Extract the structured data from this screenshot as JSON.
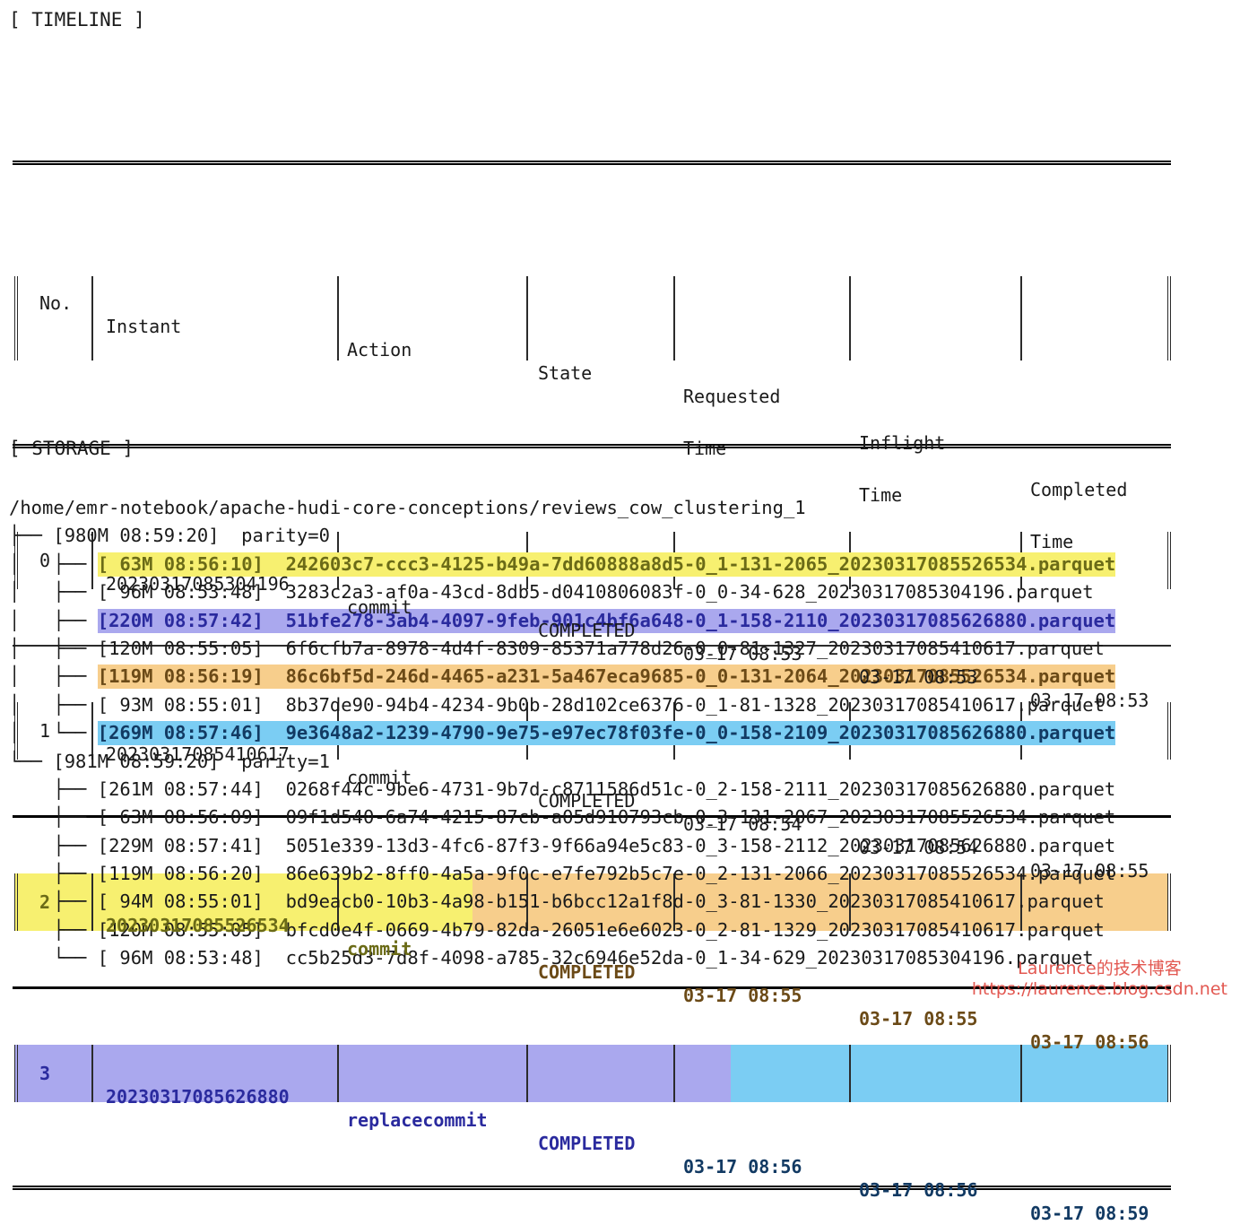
{
  "colors": {
    "yellow": "#f7f070",
    "orange": "#f7ce8c",
    "purple": "#aaa8ee",
    "blue": "#7bcdf3",
    "yellow_text": "#6b6b17",
    "orange_text": "#6b4a17",
    "purple_text": "#2a2a9e",
    "blue_text": "#123a63",
    "watermark": "#e04a43",
    "text": "#1a1a1a"
  },
  "timeline": {
    "heading": "[ TIMELINE ]",
    "columns": [
      {
        "label": "No."
      },
      {
        "label": "Instant"
      },
      {
        "label": "Action"
      },
      {
        "label": "State"
      },
      {
        "label": "Requested\nTime"
      },
      {
        "label": "Inflight\nTime"
      },
      {
        "label": "Completed\nTime"
      }
    ],
    "column_headers_flat": [
      "No.",
      "Instant",
      "Action",
      "State",
      "Requested Time",
      "Inflight Time",
      "Completed Time"
    ],
    "rows": [
      {
        "no": "0",
        "instant": "20230317085304196",
        "action": "commit",
        "state": "COMPLETED",
        "requested_time": "03-17 08:53",
        "inflight_time": "03-17 08:53",
        "completed_time": "03-17 08:53",
        "highlight": "none"
      },
      {
        "no": "1",
        "instant": "20230317085410617",
        "action": "commit",
        "state": "COMPLETED",
        "requested_time": "03-17 08:54",
        "inflight_time": "03-17 08:54",
        "completed_time": "03-17 08:55",
        "highlight": "none"
      },
      {
        "no": "2",
        "instant": "20230317085526534",
        "action": "commit",
        "state": "COMPLETED",
        "requested_time": "03-17 08:55",
        "inflight_time": "03-17 08:55",
        "completed_time": "03-17 08:56",
        "highlight": "yellow-orange"
      },
      {
        "no": "3",
        "instant": "20230317085626880",
        "action": "replacecommit",
        "state": "COMPLETED",
        "requested_time": "03-17 08:56",
        "inflight_time": "03-17 08:56",
        "completed_time": "03-17 08:59",
        "highlight": "purple-blue"
      }
    ]
  },
  "storage": {
    "heading": "[ STORAGE ]",
    "root_path": "/home/emr-notebook/apache-hudi-core-conceptions/reviews_cow_clustering_1",
    "groups": [
      {
        "connector": "├──",
        "size": "980M",
        "time": "08:59:20",
        "label": "parity=0",
        "files": [
          {
            "connector": "├──",
            "size": " 63M",
            "time": "08:56:10",
            "name": "242603c7-ccc3-4125-b49a-7dd60888a8d5-0_1-131-2065_20230317085526534.parquet",
            "highlight": "yellow"
          },
          {
            "connector": "├──",
            "size": " 96M",
            "time": "08:53:48",
            "name": "3283c2a3-af0a-43cd-8db5-d0410806083f-0_0-34-628_20230317085304196.parquet",
            "highlight": "none"
          },
          {
            "connector": "├──",
            "size": "220M",
            "time": "08:57:42",
            "name": "51bfe278-3ab4-4097-9feb-901c4bf6a648-0_1-158-2110_20230317085626880.parquet",
            "highlight": "purple"
          },
          {
            "connector": "├──",
            "size": "120M",
            "time": "08:55:05",
            "name": "6f6cfb7a-8978-4d4f-8309-85371a778d26-0_0-81-1327_20230317085410617.parquet",
            "highlight": "none"
          },
          {
            "connector": "├──",
            "size": "119M",
            "time": "08:56:19",
            "name": "86c6bf5d-246d-4465-a231-5a467eca9685-0_0-131-2064_20230317085526534.parquet",
            "highlight": "orange"
          },
          {
            "connector": "├──",
            "size": " 93M",
            "time": "08:55:01",
            "name": "8b37de90-94b4-4234-9b0b-28d102ce6376-0_1-81-1328_20230317085410617.parquet",
            "highlight": "none"
          },
          {
            "connector": "└──",
            "size": "269M",
            "time": "08:57:46",
            "name": "9e3648a2-1239-4790-9e75-e97ec78f03fe-0_0-158-2109_20230317085626880.parquet",
            "highlight": "blue"
          }
        ]
      },
      {
        "connector": "└──",
        "size": "981M",
        "time": "08:59:20",
        "label": "parity=1",
        "files": [
          {
            "connector": "├──",
            "size": "261M",
            "time": "08:57:44",
            "name": "0268f44c-9be6-4731-9b7d-c8711586d51c-0_2-158-2111_20230317085626880.parquet",
            "highlight": "none"
          },
          {
            "connector": "├──",
            "size": " 63M",
            "time": "08:56:09",
            "name": "09f1d540-6a74-4215-87cb-a05d910793cb-0_3-131-2067_20230317085526534.parquet",
            "highlight": "none"
          },
          {
            "connector": "├──",
            "size": "229M",
            "time": "08:57:41",
            "name": "5051e339-13d3-4fc6-87f3-9f66a94e5c83-0_3-158-2112_20230317085626880.parquet",
            "highlight": "none"
          },
          {
            "connector": "├──",
            "size": "119M",
            "time": "08:56:20",
            "name": "86e639b2-8ff0-4a5a-9f0c-e7fe792b5c7e-0_2-131-2066_20230317085526534.parquet",
            "highlight": "none"
          },
          {
            "connector": "├──",
            "size": " 94M",
            "time": "08:55:01",
            "name": "bd9eacb0-10b3-4a98-b151-b6bcc12a1f8d-0_3-81-1330_20230317085410617.parquet",
            "highlight": "none"
          },
          {
            "connector": "├──",
            "size": "120M",
            "time": "08:55:05",
            "name": "bfcd0e4f-0669-4b79-82da-26051e6e6023-0_2-81-1329_20230317085410617.parquet",
            "highlight": "none"
          },
          {
            "connector": "└──",
            "size": " 96M",
            "time": "08:53:48",
            "name": "cc5b25d3-7d8f-4098-a785-32c6946e52da-0_1-34-629_20230317085304196.parquet",
            "highlight": "none"
          }
        ]
      }
    ]
  },
  "watermark": {
    "line1": "Laurence的技术博客",
    "line2": "https://laurence.blog.csdn.net"
  }
}
